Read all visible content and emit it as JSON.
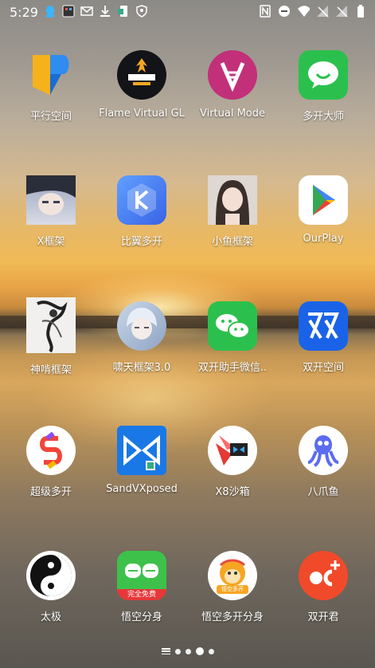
{
  "status_bar": {
    "time": "5:29",
    "left_icons": [
      "qq-icon",
      "app-icon",
      "mail-icon",
      "download-icon",
      "phone-clone-icon",
      "shield-icon"
    ],
    "right_icons": [
      "nfc-icon",
      "dnd-icon",
      "wifi-icon",
      "signal-icon",
      "no-sim-icon",
      "battery-icon"
    ]
  },
  "apps": [
    {
      "label": "平行空间",
      "icon": "parallel-space-icon"
    },
    {
      "label": "Flame Virtual GL",
      "icon": "flame-icon"
    },
    {
      "label": "Virtual Mode",
      "icon": "virtual-mode-icon"
    },
    {
      "label": "多开大师",
      "icon": "wechat-style-icon"
    },
    {
      "label": "X框架",
      "icon": "anime-photo-icon"
    },
    {
      "label": "比翼多开",
      "icon": "k-logo-icon"
    },
    {
      "label": "小鱼框架",
      "icon": "girl-photo-icon"
    },
    {
      "label": "OurPlay",
      "icon": "play-triangle-icon"
    },
    {
      "label": "神啃框架",
      "icon": "ink-painting-icon"
    },
    {
      "label": "啸天框架3.0",
      "icon": "anime-boy-icon"
    },
    {
      "label": "双开助手微信..",
      "icon": "dual-wechat-icon"
    },
    {
      "label": "双开空间",
      "icon": "shuang-icon"
    },
    {
      "label": "超级多开",
      "icon": "s-logo-icon"
    },
    {
      "label": "SandVXposed",
      "icon": "sandvx-icon"
    },
    {
      "label": "X8沙箱",
      "icon": "x8-icon"
    },
    {
      "label": "八爪鱼",
      "icon": "octopus-icon"
    },
    {
      "label": "太极",
      "icon": "taiji-icon"
    },
    {
      "label": "悟空分身",
      "icon": "wukong-icon"
    },
    {
      "label": "悟空多开分身",
      "icon": "monkey-icon"
    },
    {
      "label": "双开君",
      "icon": "dual-plus-icon"
    }
  ],
  "badges": {
    "wukong": "完全免费",
    "monkey": "悟空多开"
  },
  "page_indicator": {
    "pages": 4,
    "current": 3
  }
}
